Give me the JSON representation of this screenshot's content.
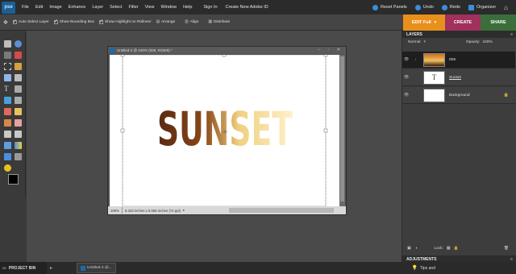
{
  "app": {
    "logo_text": "pse"
  },
  "menu": [
    "File",
    "Edit",
    "Image",
    "Enhance",
    "Layer",
    "Select",
    "Filter",
    "View",
    "Window",
    "Help",
    "Sign In",
    "Create New Adobe ID"
  ],
  "right_tools": [
    {
      "label": "Reset Panels",
      "color": "#3b8edb"
    },
    {
      "label": "Undo",
      "color": "#3b8edb"
    },
    {
      "label": "Redo",
      "color": "#3b8edb"
    },
    {
      "label": "Organizer",
      "color": "#3b8edb"
    }
  ],
  "options": {
    "auto_select": "Auto Select Layer",
    "bounding_box": "Show Bounding Box",
    "highlight": "Show Highlight on Rollover",
    "arrange": "Arrange",
    "align": "Align",
    "distribute": "Distribute"
  },
  "modes": [
    {
      "label": "EDIT Full",
      "color": "#e8901c"
    },
    {
      "label": "CREATE",
      "color": "#a0305e"
    },
    {
      "label": "SHARE",
      "color": "#3b6e3a"
    }
  ],
  "document": {
    "title": "Untitled-2 @ 100% (009, RGB/8) *",
    "headline": "SUNSET",
    "zoom": "100%",
    "size_info": "8.333 inches x 5.556 inches (72 ppi)"
  },
  "layers_panel": {
    "title": "LAYERS",
    "blend_mode": "Normal",
    "opacity_label": "Opacity:",
    "opacity_value": "100%",
    "lock_label": "Lock:",
    "layers": [
      {
        "name": "009",
        "selected": true
      },
      {
        "name": "Sunset",
        "thumb": "T"
      },
      {
        "name": "Background",
        "locked": true
      }
    ]
  },
  "adjustments": {
    "title": "ADJUSTMENTS"
  },
  "bottom": {
    "project_bin": "PROJECT BIN",
    "doc_tab": "Untitled-2 @...",
    "tips": "Tips and"
  }
}
